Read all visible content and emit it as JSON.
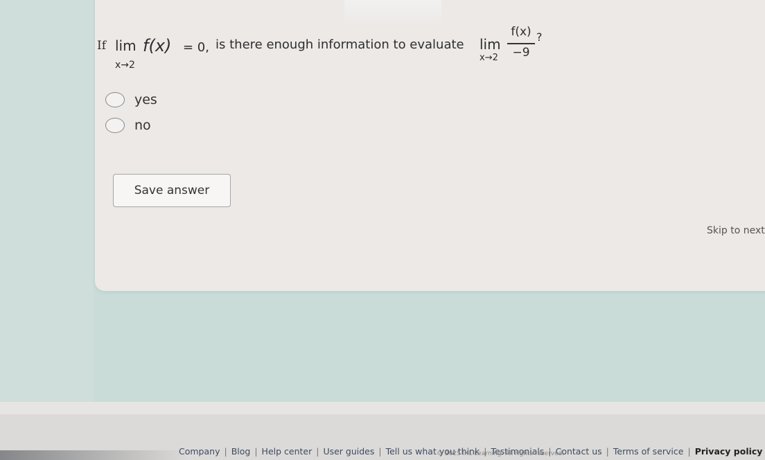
{
  "question": {
    "if_word": "If",
    "lim_word": "lim",
    "lim_sub": "x→2",
    "function_expr": "f(x)",
    "equals_part": "= 0,",
    "prompt_text": "is there enough information to evaluate",
    "lim2_word": "lim",
    "lim2_sub": "x→2",
    "fraction_numerator": "f(x)",
    "fraction_denominator": "−9",
    "question_mark": "?"
  },
  "options": [
    {
      "label": "yes",
      "selected": false
    },
    {
      "label": "no",
      "selected": false
    }
  ],
  "actions": {
    "save_label": "Save answer",
    "skip_label": "Skip to next q"
  },
  "footer": {
    "links": [
      {
        "label": "Company",
        "bold": false
      },
      {
        "label": "Blog",
        "bold": false
      },
      {
        "label": "Help center",
        "bold": false
      },
      {
        "label": "User guides",
        "bold": false
      },
      {
        "label": "Tell us what you think",
        "bold": false
      },
      {
        "label": "Testimonials",
        "bold": false
      },
      {
        "label": "Contact us",
        "bold": false
      },
      {
        "label": "Terms of service",
        "bold": false
      },
      {
        "label": "Privacy policy",
        "bold": true
      }
    ],
    "copyright": "© 2025 IXL Learning. All rights reserved."
  },
  "colors": {
    "background": "#c9dcd8",
    "card": "#ece9e7",
    "footer": "#e7e5e3"
  }
}
